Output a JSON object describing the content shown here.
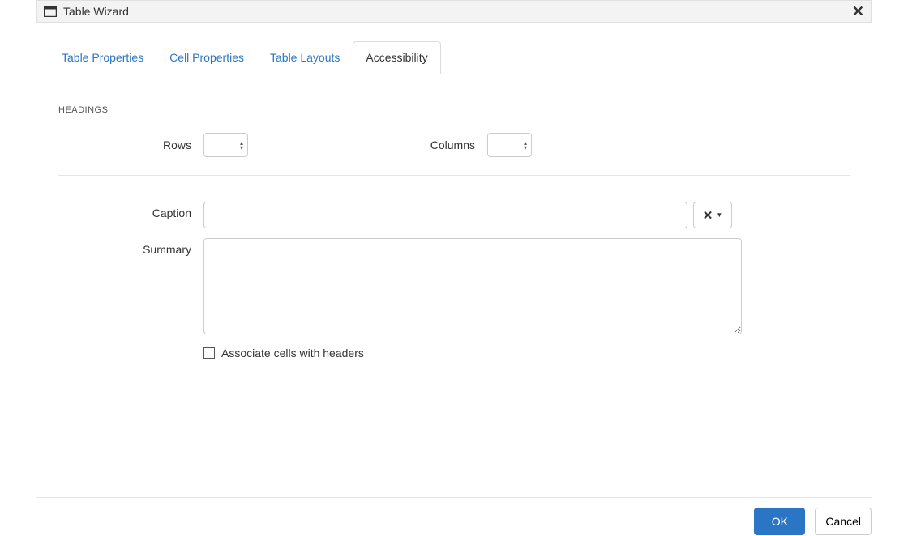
{
  "window": {
    "title": "Table Wizard",
    "close_glyph": "✕"
  },
  "tabs": {
    "properties": "Table Properties",
    "cell": "Cell Properties",
    "layouts": "Table Layouts",
    "accessibility": "Accessibility"
  },
  "headings": {
    "section_label": "HEADINGS",
    "rows_label": "Rows",
    "rows_value": "",
    "columns_label": "Columns",
    "columns_value": ""
  },
  "caption": {
    "label": "Caption",
    "value": "",
    "align_glyph": "✕",
    "align_caret": "▼"
  },
  "summary": {
    "label": "Summary",
    "value": ""
  },
  "associate": {
    "label": "Associate cells with headers",
    "checked": false
  },
  "footer": {
    "ok": "OK",
    "cancel": "Cancel"
  }
}
